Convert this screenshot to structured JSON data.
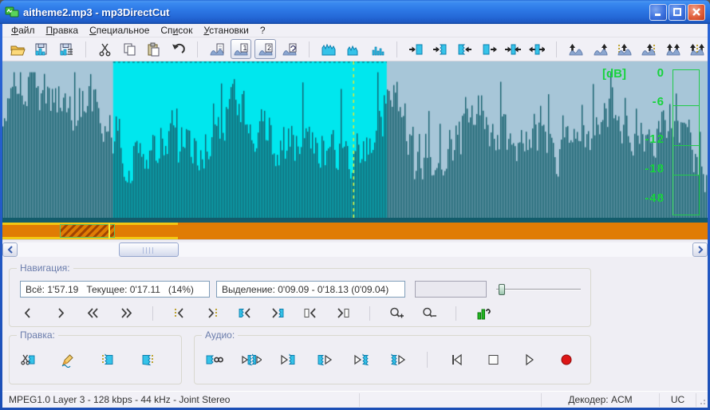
{
  "window": {
    "title": "aitheme2.mp3 - mp3DirectCut"
  },
  "menu": {
    "items": [
      {
        "label": "Файл",
        "underline": 0
      },
      {
        "label": "Правка",
        "underline": 0
      },
      {
        "label": "Специальное",
        "underline": 0
      },
      {
        "label": "Список",
        "underline": 2
      },
      {
        "label": "Установки",
        "underline": 0
      },
      {
        "label": "?",
        "underline": -1
      }
    ]
  },
  "toolbar": {
    "buttons": [
      {
        "icon": "open",
        "name": "open-button"
      },
      {
        "icon": "save-audio",
        "name": "save-audio-button"
      },
      {
        "icon": "save-parts",
        "name": "save-parts-button"
      },
      {
        "sep": true
      },
      {
        "icon": "cut",
        "name": "cut-button"
      },
      {
        "icon": "copy",
        "name": "copy-button"
      },
      {
        "icon": "paste",
        "name": "paste-button"
      },
      {
        "icon": "undo",
        "name": "undo-button"
      },
      {
        "sep": true
      },
      {
        "icon": "wave-doc",
        "name": "file-info-button"
      },
      {
        "icon": "wave-1",
        "name": "layer1-view-button",
        "framed": true
      },
      {
        "icon": "wave-2",
        "name": "layer2-view-button",
        "framed": true
      },
      {
        "icon": "wave-batch",
        "name": "batch-button"
      },
      {
        "sep": true
      },
      {
        "icon": "zoom-all",
        "name": "view-whole-button"
      },
      {
        "icon": "zoom-mid",
        "name": "view-selection-button"
      },
      {
        "icon": "zoom-detail",
        "name": "view-detail-button"
      },
      {
        "sep": true
      },
      {
        "icon": "trim1",
        "name": "sel-start-in-button"
      },
      {
        "icon": "trim2",
        "name": "sel-start-snap-button"
      },
      {
        "icon": "trim3",
        "name": "sel-end-in-button"
      },
      {
        "icon": "trim4",
        "name": "sel-end-out-button"
      },
      {
        "icon": "trim5",
        "name": "sel-shrink-button"
      },
      {
        "icon": "trim6",
        "name": "sel-expand-button"
      },
      {
        "sep": true
      },
      {
        "icon": "mark1",
        "name": "marker-prev-button"
      },
      {
        "icon": "mark2",
        "name": "marker-next-button"
      },
      {
        "icon": "mark3",
        "name": "marker-in-left-button"
      },
      {
        "icon": "mark4",
        "name": "marker-in-right-button"
      },
      {
        "icon": "mark5",
        "name": "marker-shrink-button"
      },
      {
        "icon": "mark6",
        "name": "marker-expand-button"
      }
    ]
  },
  "waveform": {
    "bg_color": "#a7c6d8",
    "bar_color": "#15606e",
    "selection_color": "#00e7ee",
    "cursor_color": "#d8e83c",
    "selection_start_pct": 15.7,
    "selection_end_pct": 54.5,
    "cursor_pct": 49.8,
    "db_unit": "[dB]",
    "db_ticks": [
      "0",
      "-6",
      "-12",
      "-18",
      "-48"
    ]
  },
  "position_bar": {
    "view_start_pct": 0,
    "view_end_pct": 24.9,
    "selection_start_pct": 8.1,
    "selection_width_pct": 7.9,
    "cursor_pct": 15.0
  },
  "scrollbar": {
    "thumb_left_pct": 15,
    "thumb_width_pct": 8.5
  },
  "navigation": {
    "label": "Навигация:",
    "total_field": "Всё: 1'57.19   Текущее: 0'17.11   (14%)",
    "selection_field": "Выделение: 0'09.09 - 0'18.13 (0'09.04)",
    "aux_field": "",
    "slider_value_pct": 3,
    "buttons": [
      {
        "icon": "chev-l",
        "name": "step-back-button"
      },
      {
        "icon": "chev-r",
        "name": "step-forward-button"
      },
      {
        "icon": "chev2-l",
        "name": "fast-back-button"
      },
      {
        "icon": "chev2-r",
        "name": "fast-forward-button"
      },
      {
        "sep": true
      },
      {
        "icon": "cue-chev-l",
        "name": "prev-cue-button"
      },
      {
        "icon": "cue-chev-r",
        "name": "next-cue-button"
      },
      {
        "icon": "sel-chev-l",
        "name": "goto-selection-start-button"
      },
      {
        "icon": "sel-chev-r",
        "name": "goto-selection-end-button"
      },
      {
        "icon": "box-chev-l",
        "name": "prev-frame-button"
      },
      {
        "icon": "box-chev-r",
        "name": "next-frame-button"
      },
      {
        "sep": true
      },
      {
        "icon": "zoom-in",
        "name": "zoom-in-button"
      },
      {
        "icon": "zoom-out",
        "name": "zoom-out-button"
      },
      {
        "sep": true
      },
      {
        "icon": "vu",
        "name": "vu-meter-button"
      }
    ]
  },
  "edit": {
    "label": "Правка:",
    "buttons": [
      {
        "icon": "cut-sel",
        "name": "cut-selection-button"
      },
      {
        "icon": "pencil",
        "name": "edit-pen-button"
      },
      {
        "icon": "set-start",
        "name": "set-selection-start-button"
      },
      {
        "icon": "set-end",
        "name": "set-selection-end-button"
      }
    ]
  },
  "audio": {
    "label": "Аудио:",
    "buttons": [
      {
        "icon": "loop-sel",
        "name": "loop-play-button"
      },
      {
        "icon": "play-around",
        "name": "play-around-cut-button"
      },
      {
        "icon": "play-to-sel",
        "name": "play-to-selection-button"
      },
      {
        "icon": "play-from-sel",
        "name": "play-from-selection-button"
      },
      {
        "icon": "play-to-end",
        "name": "play-to-end-button"
      },
      {
        "icon": "play-from-end",
        "name": "play-from-end-button"
      },
      {
        "sep": true
      },
      {
        "icon": "skip-start",
        "name": "skip-to-start-button"
      },
      {
        "icon": "stop",
        "name": "stop-button"
      },
      {
        "icon": "play",
        "name": "play-button"
      },
      {
        "icon": "record",
        "name": "record-button"
      }
    ]
  },
  "statusbar": {
    "format": "MPEG1.0 Layer 3 - 128 kbps - 44 kHz - Joint Stereo",
    "decoder": "Декодер: ACM",
    "mode": "UC"
  }
}
